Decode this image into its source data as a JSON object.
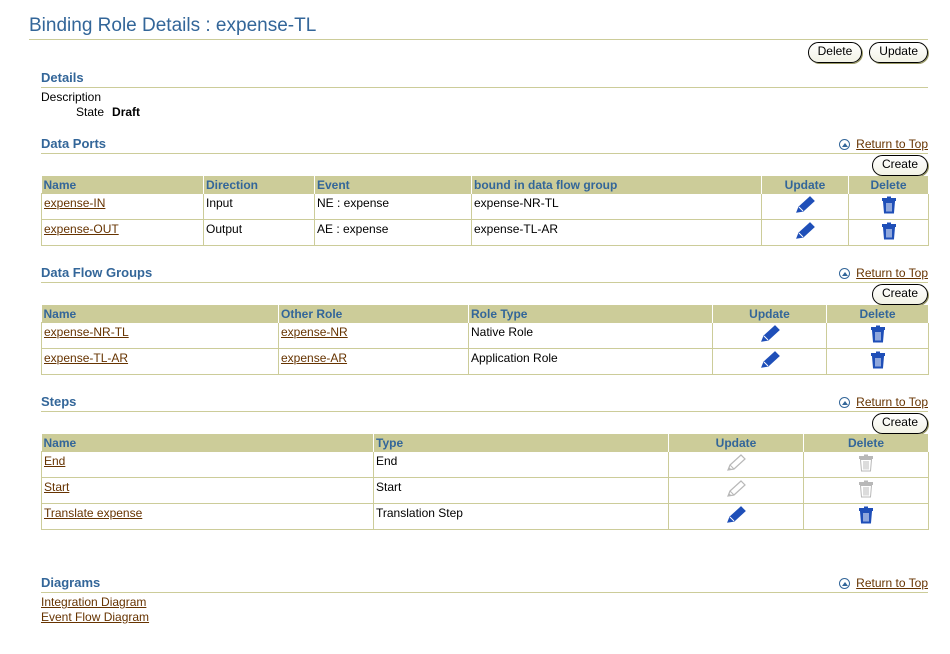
{
  "page": {
    "title": "Binding Role Details : expense-TL",
    "delete_label": "Delete",
    "update_label": "Update"
  },
  "return_to_top": "Return to Top",
  "create_label": "Create",
  "details": {
    "heading": "Details",
    "description_label": "Description",
    "state_label": "State",
    "state_value": "Draft"
  },
  "data_ports": {
    "heading": "Data Ports",
    "columns": [
      "Name",
      "Direction",
      "Event",
      "bound in data flow group",
      "Update",
      "Delete"
    ],
    "rows": [
      {
        "name": "expense-IN",
        "direction": "Input",
        "event": "NE : expense",
        "group": "expense-NR-TL"
      },
      {
        "name": "expense-OUT",
        "direction": "Output",
        "event": "AE : expense",
        "group": "expense-TL-AR"
      }
    ]
  },
  "data_flow_groups": {
    "heading": "Data Flow Groups",
    "columns": [
      "Name",
      "Other Role",
      "Role Type",
      "Update",
      "Delete"
    ],
    "rows": [
      {
        "name": "expense-NR-TL",
        "other_role": "expense-NR",
        "role_type": "Native Role"
      },
      {
        "name": "expense-TL-AR",
        "other_role": "expense-AR",
        "role_type": "Application Role"
      }
    ]
  },
  "steps": {
    "heading": "Steps",
    "columns": [
      "Name",
      "Type",
      "Update",
      "Delete"
    ],
    "rows": [
      {
        "name": "End",
        "type": "End",
        "enabled": false
      },
      {
        "name": "Start",
        "type": "Start",
        "enabled": false
      },
      {
        "name": "Translate expense",
        "type": "Translation Step",
        "enabled": true
      }
    ]
  },
  "diagrams": {
    "heading": "Diagrams",
    "links": [
      "Integration Diagram",
      "Event Flow Diagram"
    ]
  },
  "colors": {
    "accent": "#336699",
    "link": "#663300",
    "header_bg": "#cccc99",
    "icon_blue": "#1f4fb8",
    "icon_disabled": "#b8b8b8"
  }
}
